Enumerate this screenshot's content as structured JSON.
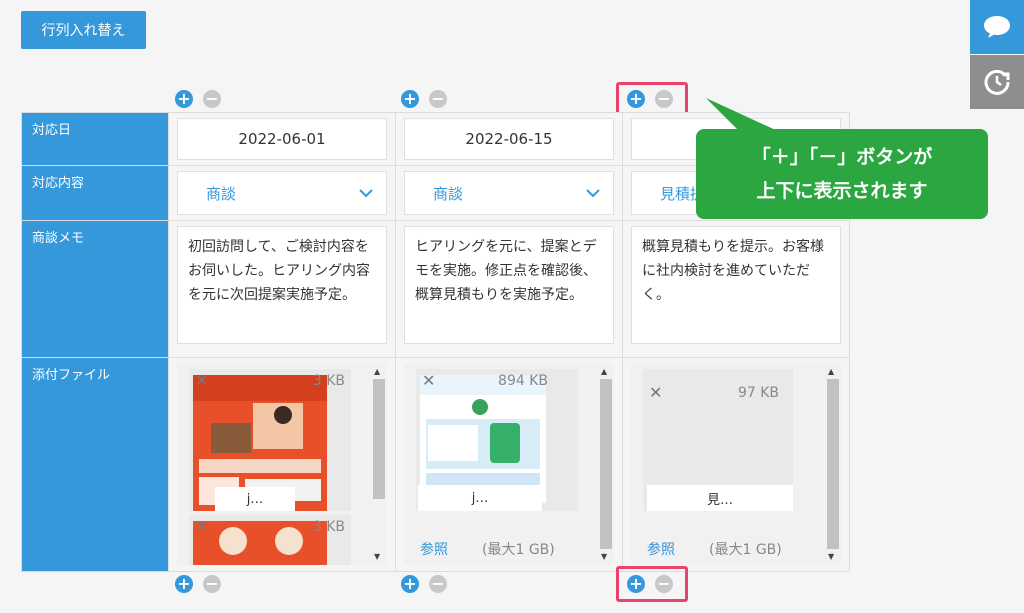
{
  "toolbar": {
    "swap_label": "行列入れ替え"
  },
  "side": {
    "chat_icon": "chat-bubble-icon",
    "refresh_icon": "refresh-clock-icon"
  },
  "controls": {
    "plus": "+",
    "minus": "−"
  },
  "rows": {
    "date_label": "対応日",
    "type_label": "対応内容",
    "memo_label": "商談メモ",
    "file_label": "添付ファイル"
  },
  "columns": [
    {
      "date": "2022-06-01",
      "type": "商談",
      "memo": "初回訪問して、ご検討内容をお伺いした。ヒアリング内容を元に次回提案実施予定。",
      "files": [
        {
          "size": "3 KB",
          "name": "j…"
        },
        {
          "size": "3 KB",
          "name": ""
        }
      ]
    },
    {
      "date": "2022-06-15",
      "type": "商談",
      "memo": "ヒアリングを元に、提案とデモを実施。修正点を確認後、概算見積もりを実施予定。",
      "files": [
        {
          "size": "894 KB",
          "name": "j…"
        }
      ],
      "browse": "参照",
      "max": "(最大1 GB)"
    },
    {
      "date": "20",
      "type": "見積提",
      "memo": "概算見積もりを提示。お客様に社内検討を進めていただく。",
      "files": [
        {
          "size": "97 KB",
          "name": "見…"
        }
      ],
      "browse": "参照",
      "max": "(最大1 GB)"
    }
  ],
  "callout": {
    "line1": "「＋」「－」ボタンが",
    "line2": "上下に表示されます"
  }
}
